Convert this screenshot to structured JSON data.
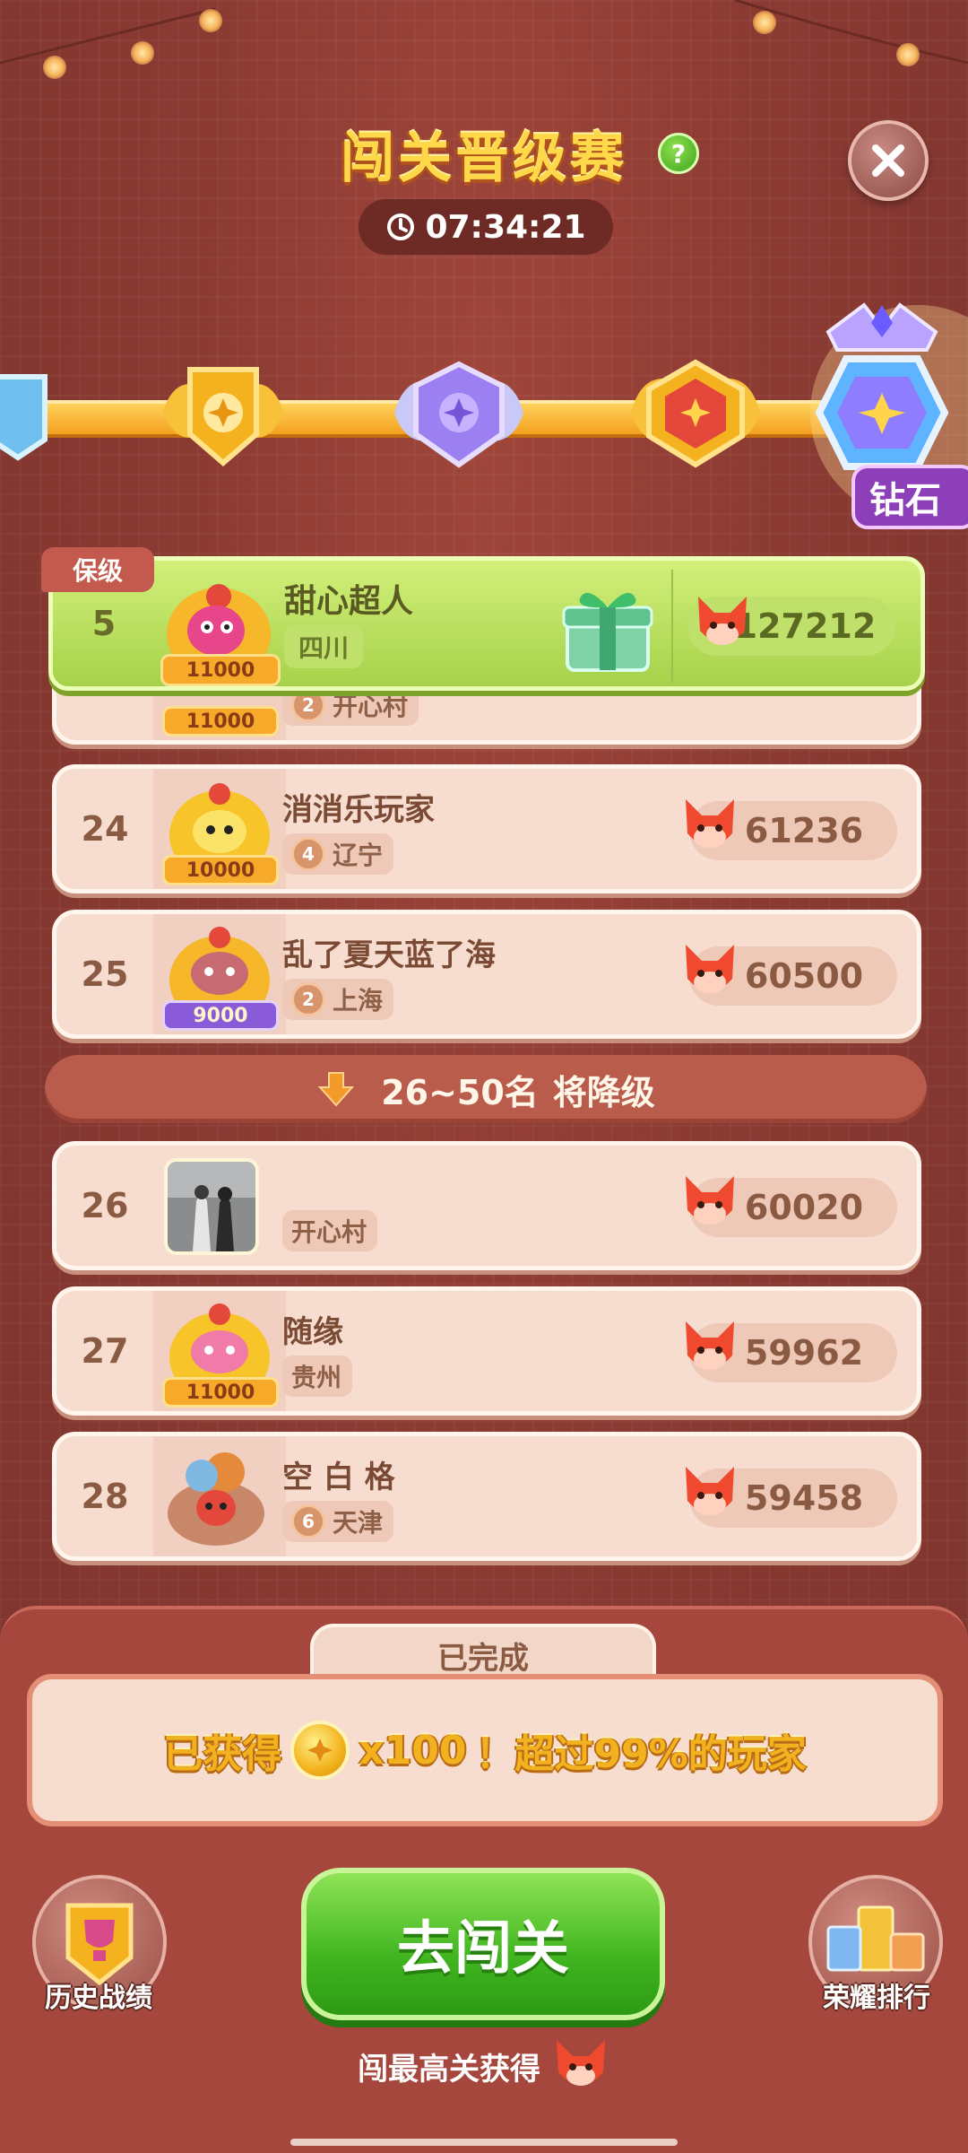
{
  "header": {
    "title": "闯关晋级赛",
    "help_icon": "question-icon",
    "close_icon": "close-icon",
    "timer": "07:34:21"
  },
  "tiers": {
    "current_label": "钻石"
  },
  "my_entry": {
    "tag": "保级",
    "rank": "5",
    "name": "甜心超人",
    "region": "四川",
    "avatar_badge": "11000",
    "score": "127212"
  },
  "leaderboard": [
    {
      "rank": "24",
      "name": "消消乐玩家",
      "level": "4",
      "region": "辽宁",
      "badge": "10000",
      "score": "61236"
    },
    {
      "rank": "25",
      "name": "乱了夏天蓝了海",
      "level": "2",
      "region": "上海",
      "badge": "9000",
      "score": "60500"
    },
    {
      "rank": "26",
      "name": "",
      "level": "",
      "region": "开心村",
      "badge": "",
      "score": "60020"
    },
    {
      "rank": "27",
      "name": "随缘",
      "level": "",
      "region": "贵州",
      "badge": "11000",
      "score": "59962"
    },
    {
      "rank": "28",
      "name": "空 白 格",
      "level": "6",
      "region": "天津",
      "badge": "",
      "score": "59458"
    }
  ],
  "partial_row": {
    "level": "2",
    "region": "开心村",
    "badge": "11000"
  },
  "demotion_banner": {
    "range": "26~50名",
    "text": "将降级"
  },
  "result": {
    "tab": "已完成",
    "prefix": "已获得",
    "amount": "x100",
    "suffix": "！超过99%的玩家"
  },
  "actions": {
    "go_button": "去闯关",
    "go_sub": "闯最高关获得",
    "history": "历史战绩",
    "ranking": "荣耀排行"
  },
  "colors": {
    "background": "#8a3a32",
    "highlight_row": "#b8dc5a",
    "go_button": "#3fb51f",
    "gold": "#ffd84a"
  }
}
